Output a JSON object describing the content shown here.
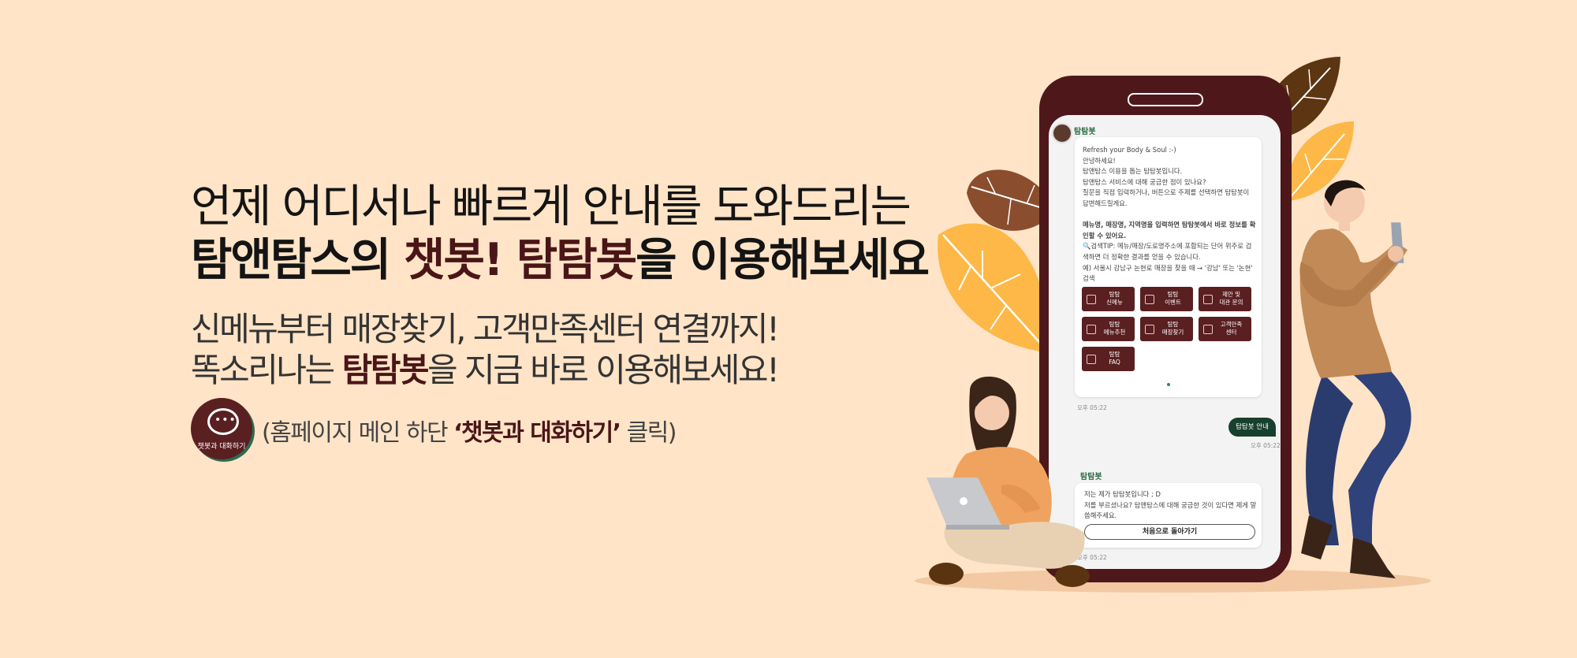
{
  "headline": {
    "line1": "언제 어디서나 빠르게 안내를 도와드리는",
    "line2_part1": "탐앤탐스의 ",
    "line2_part2": "챗봇! 탐탐봇",
    "line2_part3": "을 이용해보세요"
  },
  "subtitle": {
    "line1": "신메뉴부터 매장찾기, 고객만족센터 연결까지!",
    "line2_part1": "똑소리나는 ",
    "line2_part2": "탐탐봇",
    "line2_part3": "을 지금 바로 이용해보세요!"
  },
  "cta": {
    "badge_label": "챗봇과 대화하기",
    "badge_dots": "•••",
    "text_part1": "(홈페이지 메인 하단 ",
    "text_part2": "‘챗봇과 대화하기’",
    "text_part3": " 클릭)"
  },
  "chat": {
    "bot_name": "탐탐봇",
    "greeting": "Refresh your Body & Soul :-)\n안녕하세요!\n탐앤탐스 이용을 돕는 탐탐봇입니다.\n탐앤탐스 서비스에 대해 궁금한 점이 있나요?\n질문을 직접 입력하거나, 버튼으로 주제를 선택하면 탐탐봇이 답변해드릴게요.",
    "guide_bold": "메뉴명, 매장명, 지역명을 입력하면 탐탐봇에서 바로 정보를 확인할 수 있어요.",
    "guide_tip": "🔍검색TIP: 메뉴/매장/도로명주소에 포함되는 단어 위주로 검색하면 더 정확한 결과를 얻을 수 있습니다.\n예) 서울시 강남구 논현로 매장을 찾을 때 → '강남' 또는 '논현' 검색",
    "quick_buttons": [
      {
        "label": "탐탐\n신메뉴"
      },
      {
        "label": "탐탐\n이벤트"
      },
      {
        "label": "제안 및\n대관 문의"
      },
      {
        "label": "탐탐\n메뉴추천"
      },
      {
        "label": "탐탐\n매장찾기"
      },
      {
        "label": "고객만족\n센터"
      },
      {
        "label": "탐탐\nFAQ"
      }
    ],
    "time1": "오후 05:22",
    "user_message": "탐탐봇 안내",
    "time2": "오후 05:22",
    "bot_name2": "탐탐봇",
    "reply": "저는 제가 탐탐봇입니다 ; D\n저를 부르셨나요? 탐앤탐스에 대해 궁금한 것이 있다면 제게 말씀해주세요.",
    "home_button": "처음으로 돌아가기",
    "time3": "오후 05:22"
  },
  "colors": {
    "background": "#FFE4C7",
    "brand": "#4B1518",
    "accent_green": "#17402E"
  }
}
